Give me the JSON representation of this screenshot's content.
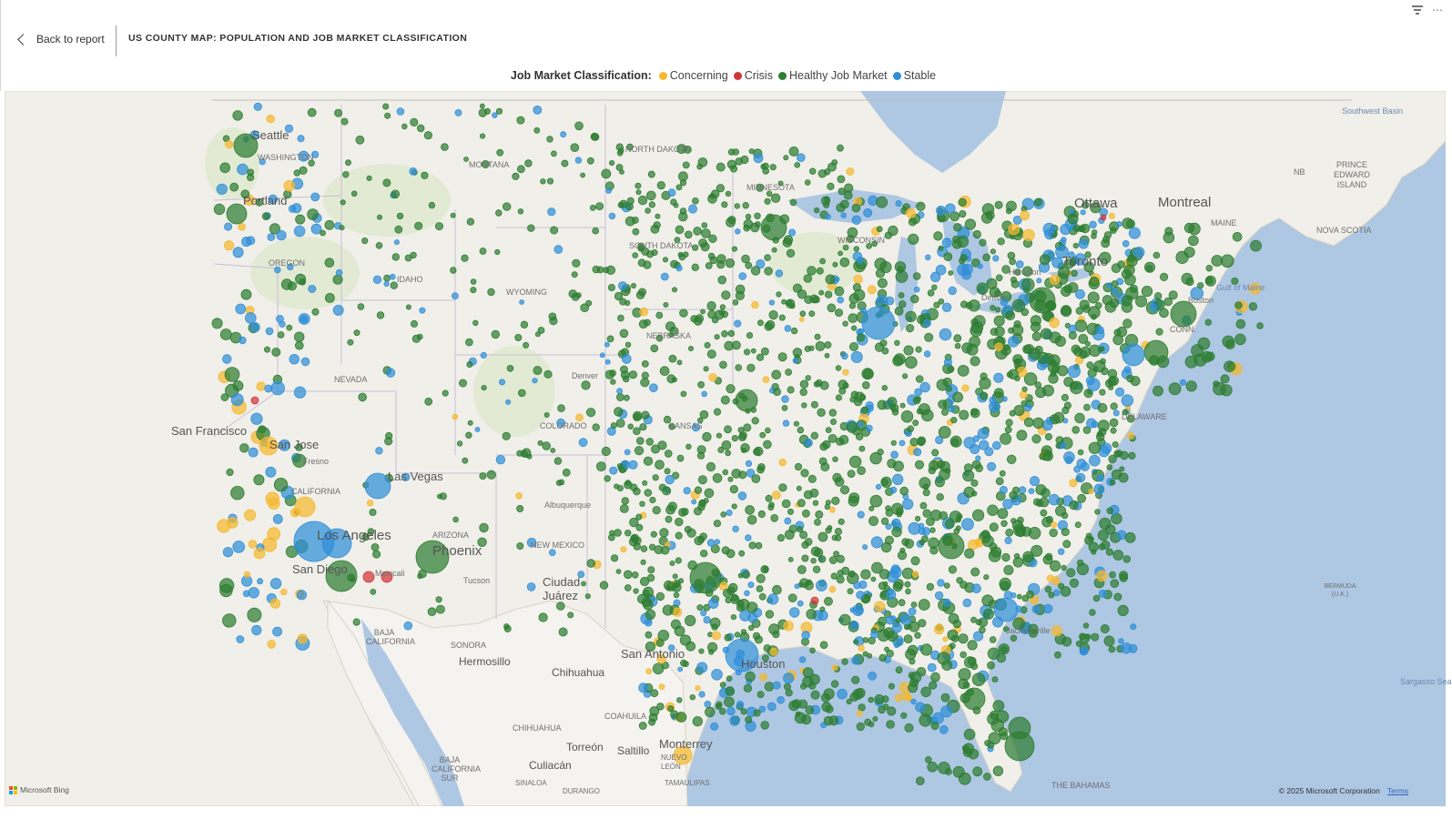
{
  "header": {
    "back_label": "Back to report",
    "title": "US COUNTY MAP: POPULATION AND JOB MARKET CLASSIFICATION"
  },
  "legend": {
    "title": "Job Market Classification:",
    "items": [
      {
        "label": "Concerning",
        "color": "#F5B82E"
      },
      {
        "label": "Crisis",
        "color": "#D13438"
      },
      {
        "label": "Healthy Job Market",
        "color": "#2E7D32"
      },
      {
        "label": "Stable",
        "color": "#2F8FD8"
      }
    ]
  },
  "map": {
    "labels": {
      "seattle": "Seattle",
      "washington": "WASHINGTON",
      "portland": "Portland",
      "oregon": "OREGON",
      "idaho": "IDAHO",
      "montana": "MONTANA",
      "north_dakota": "NORTH DAKOTA",
      "south_dakota": "SOUTH DAKOTA",
      "minnesota": "MINNESOTA",
      "wisconsin": "WISCONSIN",
      "wyoming": "WYOMING",
      "nevada": "NEVADA",
      "san_francisco": "San Francisco",
      "san_jose": "San Jose",
      "fresno": "Fresno",
      "california": "CALIFORNIA",
      "las_vegas": "Las Vegas",
      "los_angeles": "Los Angeles",
      "san_diego": "San Diego",
      "mexicali": "Mexicali",
      "arizona": "ARIZONA",
      "phoenix": "Phoenix",
      "tucson": "Tucson",
      "new_mexico": "NEW MEXICO",
      "albuquerque": "Albuquerque",
      "ciudad_juarez": "Ciudad Juárez",
      "denver": "Denver",
      "colorado": "COLORADO",
      "nebraska": "NEBRASKA",
      "kansas": "KANSAS",
      "san_antonio": "San Antonio",
      "houston": "Houston",
      "jacksonville": "Jacksonville",
      "detroit": "Detroit",
      "toronto": "Toronto",
      "hamilton": "Hamilton",
      "ottawa": "Ottawa",
      "montreal": "Montreal",
      "maine": "MAINE",
      "boston": "Boston",
      "gulf_of_maine": "Gulf of Maine",
      "connecticut": "CONN.",
      "delaware": "DELAWARE",
      "nb": "NB",
      "prince_edward_island": "PRINCE EDWARD ISLAND",
      "nova_scotia": "NOVA SCOTIA",
      "southwest_basin": "Southwest Basin",
      "bermuda": "BERMUDA (U.K.)",
      "sargasso_sea": "Sargasso Sea",
      "the_bahamas": "THE BAHAMAS",
      "baja_california": "BAJA CALIFORNIA",
      "baja_california_sur": "BAJA CALIFORNIA SUR",
      "sonora": "SONORA",
      "hermosillo": "Hermosillo",
      "chihuahua_city": "Chihuahua",
      "chihuahua_state": "CHIHUAHUA",
      "coahuila": "COAHUILA",
      "torreon": "Torreón",
      "saltillo": "Saltillo",
      "monterrey": "Monterrey",
      "nuevo_leon": "NUEVO LEÓN",
      "tamaulipas": "TAMAULIPAS",
      "culiacan": "Culiacán",
      "sinaloa": "SINALOA",
      "durango": "DURANGO"
    }
  },
  "footer": {
    "bing": "Microsoft Bing",
    "copyright": "© 2025 Microsoft Corporation",
    "terms": "Terms"
  }
}
